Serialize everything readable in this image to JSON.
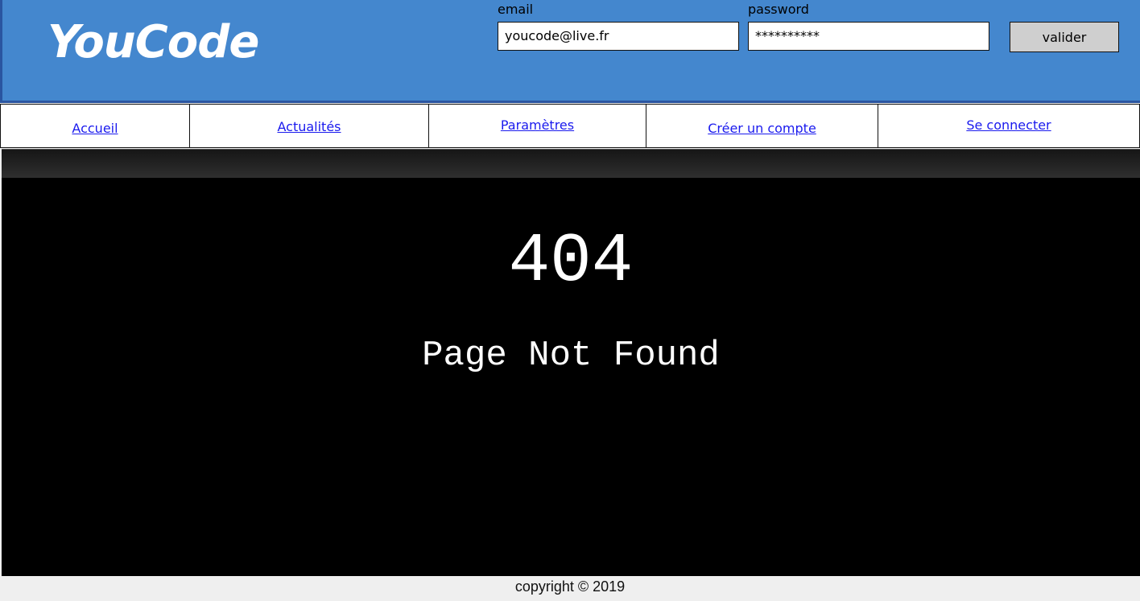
{
  "header": {
    "logo": "YouCode",
    "email_label": "email",
    "email_value": "youcode@live.fr",
    "password_label": "password",
    "password_value": "**********",
    "submit_label": "valider"
  },
  "nav": {
    "items": [
      "Accueil",
      "Actualités",
      "Paramètres",
      "Créer un compte",
      "Se connecter"
    ]
  },
  "main": {
    "code": "404",
    "message": "Page Not Found"
  },
  "footer": {
    "copyright": "copyright © 2019"
  },
  "colors": {
    "header_bg": "#4487ce",
    "link": "#1a1aee",
    "main_bg": "#000000"
  }
}
